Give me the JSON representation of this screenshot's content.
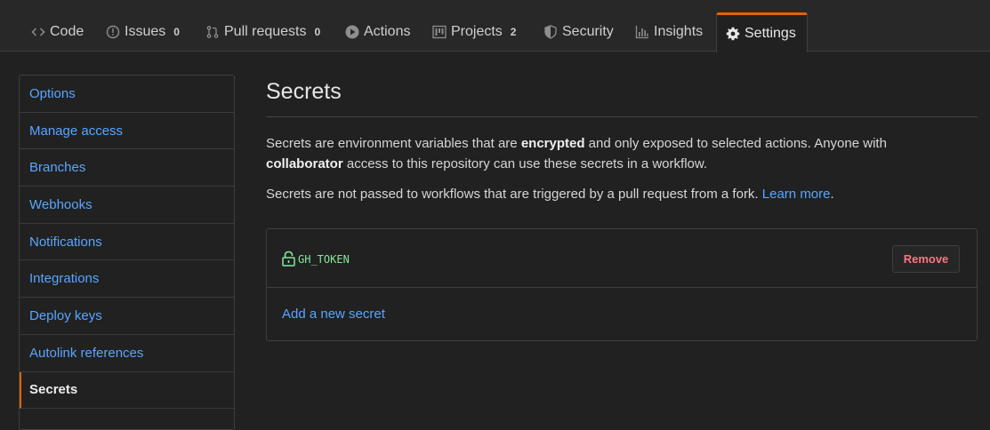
{
  "nav": {
    "tabs": [
      {
        "label": "Code",
        "icon": "code-icon",
        "count": null
      },
      {
        "label": "Issues",
        "icon": "issue-icon",
        "count": "0"
      },
      {
        "label": "Pull requests",
        "icon": "pull-request-icon",
        "count": "0"
      },
      {
        "label": "Actions",
        "icon": "play-icon",
        "count": null
      },
      {
        "label": "Projects",
        "icon": "project-icon",
        "count": "2"
      },
      {
        "label": "Security",
        "icon": "shield-icon",
        "count": null
      },
      {
        "label": "Insights",
        "icon": "graph-icon",
        "count": null
      },
      {
        "label": "Settings",
        "icon": "gear-icon",
        "count": null,
        "selected": true
      }
    ]
  },
  "sidebar": {
    "items": [
      {
        "label": "Options"
      },
      {
        "label": "Manage access"
      },
      {
        "label": "Branches"
      },
      {
        "label": "Webhooks"
      },
      {
        "label": "Notifications"
      },
      {
        "label": "Integrations"
      },
      {
        "label": "Deploy keys"
      },
      {
        "label": "Autolink references"
      },
      {
        "label": "Secrets",
        "active": true
      }
    ]
  },
  "main": {
    "title": "Secrets",
    "p1": {
      "t1": "Secrets are environment variables that are ",
      "b1": "encrypted",
      "t2": " and only exposed to selected actions. Anyone with ",
      "b2": "collaborator",
      "t3": " access to this repository can use these secrets in a workflow."
    },
    "p2": {
      "t1": "Secrets are not passed to workflows that are triggered by a pull request from a fork. ",
      "link": "Learn more",
      "t2": "."
    },
    "secrets": [
      {
        "name": "GH_TOKEN",
        "remove_label": "Remove"
      }
    ],
    "add_label": "Add a new secret"
  },
  "colors": {
    "accent": "#e36209",
    "link": "#58a6ff",
    "secret_green": "#85e89d",
    "danger": "#f97583"
  }
}
